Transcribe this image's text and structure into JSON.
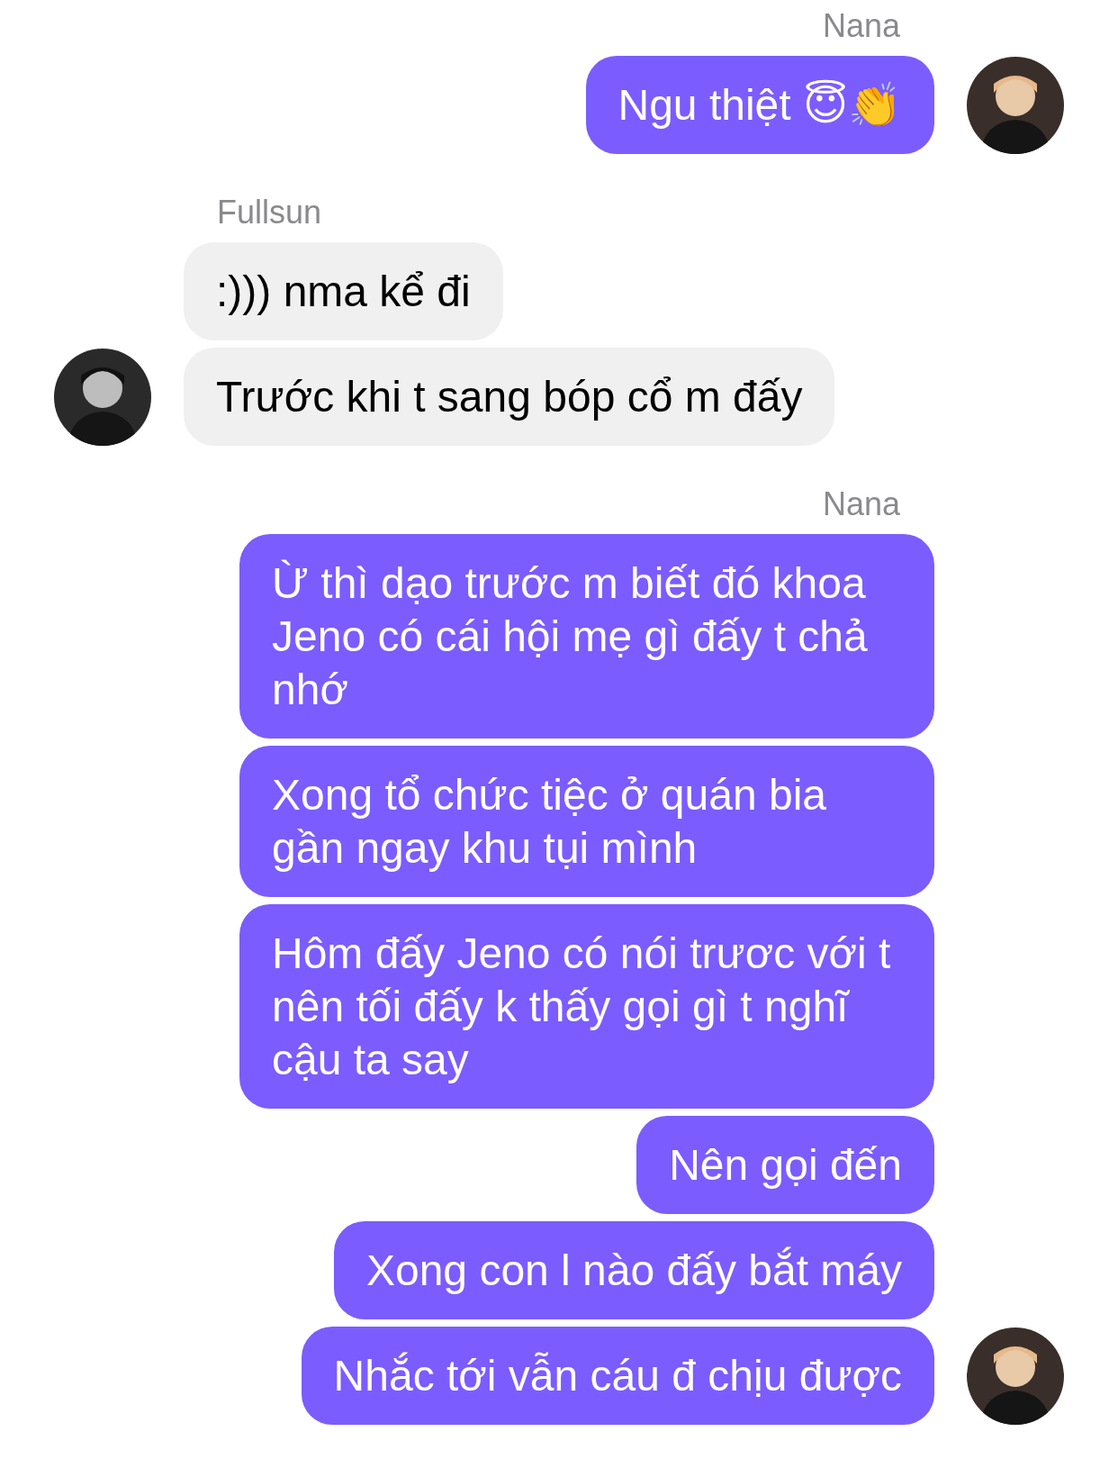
{
  "groups": [
    {
      "sender": "Nana",
      "kind": "outgoing",
      "messages": [
        "Ngu thiệt 😇👏"
      ]
    },
    {
      "sender": "Fullsun",
      "kind": "incoming",
      "messages": [
        ":))) nma kể đi",
        "Trước khi t sang bóp cổ m đấy"
      ]
    },
    {
      "sender": "Nana",
      "kind": "outgoing",
      "messages": [
        "Ừ thì dạo trước m biết đó khoa Jeno có cái hội mẹ gì đấy t chả nhớ",
        "Xong tổ chức tiệc ở quán bia gần ngay khu tụi mình",
        "Hôm đấy Jeno có nói trươc với t nên tối đấy k thấy gọi gì t nghĩ cậu ta say",
        "Nên gọi đến",
        "Xong con l nào đấy bắt máy",
        "Nhắc tới vẫn cáu đ chịu được"
      ]
    }
  ]
}
